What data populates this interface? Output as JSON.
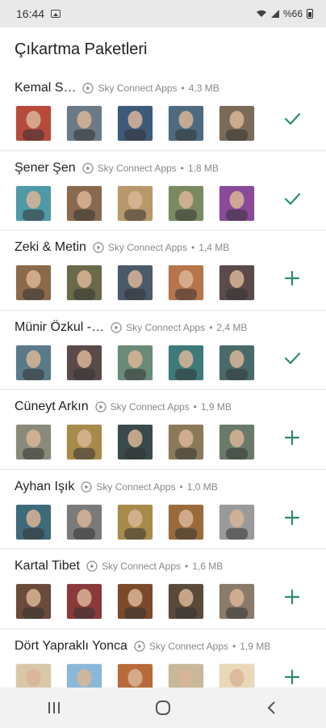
{
  "status_bar": {
    "time": "16:44",
    "battery_text": "%66",
    "icons": [
      "gallery-icon",
      "wifi-icon",
      "signal-icon",
      "battery-icon"
    ]
  },
  "app": {
    "title": "Çıkartma Paketleri"
  },
  "packs": [
    {
      "name": "Kemal S…",
      "publisher": "Sky Connect Apps",
      "size": "4,3 MB",
      "added": true,
      "stickers": [
        "#b84a3c",
        "#6b7a86",
        "#3e5a7a",
        "#4d6a80",
        "#7a6a58"
      ]
    },
    {
      "name": "Şener Şen",
      "publisher": "Sky Connect Apps",
      "size": "1,8 MB",
      "added": true,
      "stickers": [
        "#4e9aa6",
        "#8a6a4e",
        "#b8986a",
        "#7a8a60",
        "#8a4a9a"
      ]
    },
    {
      "name": "Zeki & Metin",
      "publisher": "Sky Connect Apps",
      "size": "1,4 MB",
      "added": false,
      "stickers": [
        "#8a6a4a",
        "#6a6a4a",
        "#4a5a6a",
        "#b8744a",
        "#5a4a4a"
      ]
    },
    {
      "name": "Münir Özkul -…",
      "publisher": "Sky Connect Apps",
      "size": "2,4 MB",
      "added": true,
      "stickers": [
        "#5a7a8a",
        "#5a4a4a",
        "#6a8a7a",
        "#3e7a7a",
        "#4a6a6a"
      ]
    },
    {
      "name": "Cüneyt Arkın",
      "publisher": "Sky Connect Apps",
      "size": "1,9 MB",
      "added": false,
      "stickers": [
        "#8a8a7a",
        "#a88a4a",
        "#3a4a4a",
        "#8a7a5a",
        "#6a7a6a"
      ]
    },
    {
      "name": "Ayhan Işık",
      "publisher": "Sky Connect Apps",
      "size": "1,0 MB",
      "added": false,
      "stickers": [
        "#3e6a7a",
        "#7a7a7a",
        "#a88a4a",
        "#9a6a3a",
        "#9a9a9a"
      ]
    },
    {
      "name": "Kartal Tibet",
      "publisher": "Sky Connect Apps",
      "size": "1,6 MB",
      "added": false,
      "stickers": [
        "#6a4a3a",
        "#8a3a3a",
        "#7a4a2a",
        "#5a4a3a",
        "#8a7a6a"
      ]
    },
    {
      "name": "Dört Yapraklı Yonca",
      "publisher": "Sky Connect Apps",
      "size": "1,9 MB",
      "added": false,
      "stickers": [
        "#d8c8a8",
        "#8ab8d8",
        "#b86a3a",
        "#c8b89a",
        "#e8d8b8"
      ]
    }
  ],
  "colors": {
    "accent": "#2e8b6f",
    "status_bar_bg": "#e9e9e9",
    "nav_bar_bg": "#f2f2f2"
  },
  "nav": {
    "items": [
      "recent-apps-icon",
      "home-icon",
      "back-icon"
    ]
  }
}
